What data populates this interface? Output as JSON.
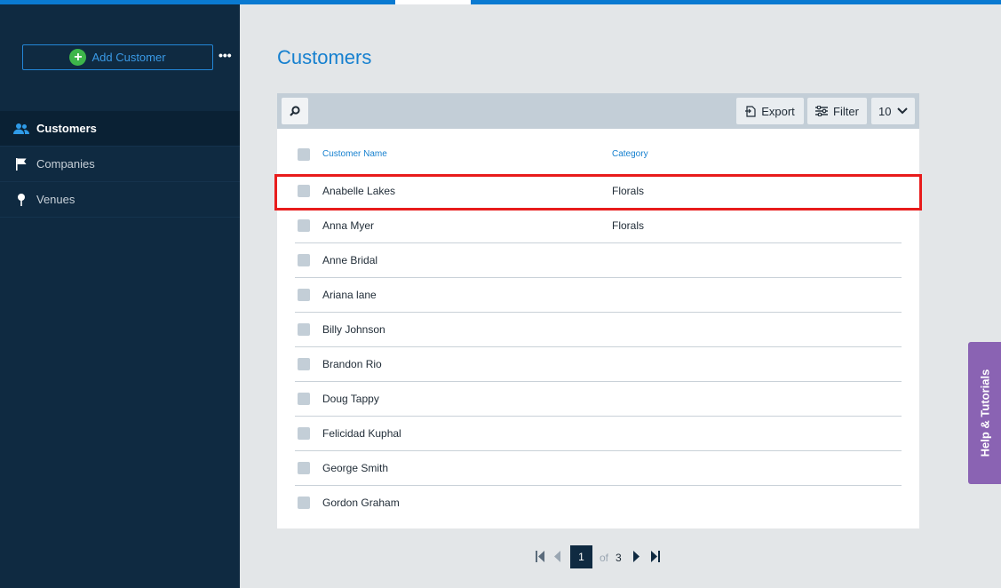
{
  "sidebar": {
    "add_button_label": "Add Customer",
    "more_label": "•••",
    "nav": [
      {
        "label": "Customers",
        "icon": "users-icon"
      },
      {
        "label": "Companies",
        "icon": "flag-icon"
      },
      {
        "label": "Venues",
        "icon": "pin-icon"
      }
    ]
  },
  "main": {
    "title": "Customers"
  },
  "toolbar": {
    "export_label": "Export",
    "filter_label": "Filter",
    "per_page": "10"
  },
  "table": {
    "columns": [
      "Customer Name",
      "Category"
    ],
    "rows": [
      {
        "name": "Anabelle Lakes",
        "category": "Florals"
      },
      {
        "name": "Anna Myer",
        "category": "Florals"
      },
      {
        "name": "Anne Bridal",
        "category": ""
      },
      {
        "name": "Ariana lane",
        "category": ""
      },
      {
        "name": "Billy Johnson",
        "category": ""
      },
      {
        "name": "Brandon Rio",
        "category": ""
      },
      {
        "name": "Doug Tappy",
        "category": ""
      },
      {
        "name": "Felicidad Kuphal",
        "category": ""
      },
      {
        "name": "George Smith",
        "category": ""
      },
      {
        "name": "Gordon Graham",
        "category": ""
      }
    ]
  },
  "pagination": {
    "current": "1",
    "of_label": "of",
    "total": "3"
  },
  "help_tab": {
    "label": "Help & Tutorials"
  },
  "colors": {
    "accent": "#1680cf",
    "sidebar_bg": "#0f2a41",
    "help_tab": "#8a63b3",
    "highlight": "#e81c1c"
  }
}
